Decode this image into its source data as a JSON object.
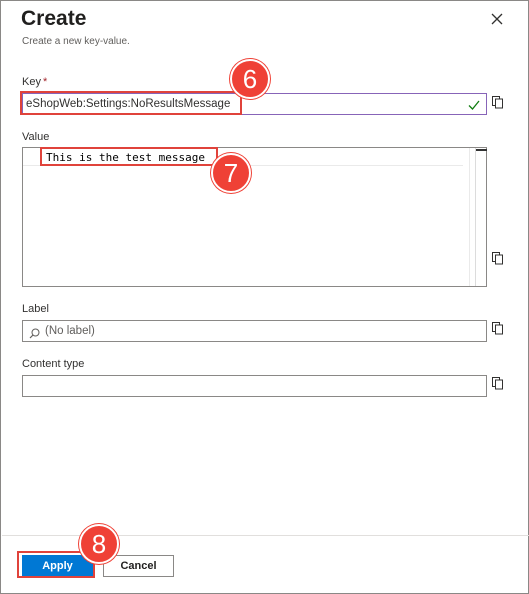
{
  "header": {
    "title": "Create",
    "subtitle": "Create a new key-value.",
    "close_icon": "close-icon"
  },
  "key": {
    "label": "Key",
    "required_mark": "*",
    "value": "eShopWeb:Settings:NoResultsMessage",
    "valid_icon": "checkmark-icon"
  },
  "value_field": {
    "label": "Value",
    "value": "This is the test message"
  },
  "label_field": {
    "label": "Label",
    "placeholder": "(No label)",
    "search_icon": "search-icon"
  },
  "content_type": {
    "label": "Content type",
    "value": ""
  },
  "footer": {
    "apply_label": "Apply",
    "cancel_label": "Cancel"
  },
  "annotations": {
    "step_6": "6",
    "step_7": "7",
    "step_8": "8"
  },
  "colors": {
    "accent": "#0078d4",
    "callout": "#ef4136",
    "key_border": "#8764b8",
    "valid": "#107c10"
  }
}
